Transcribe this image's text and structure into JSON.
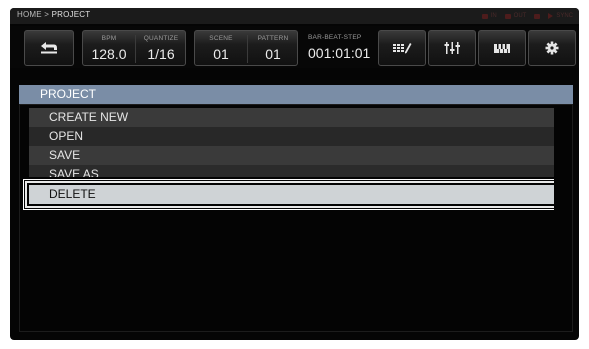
{
  "status": {
    "breadcrumb_home": "HOME",
    "breadcrumb_sep": ">",
    "breadcrumb_current": "PROJECT",
    "indicators": [
      "IN",
      "OUT",
      "",
      "SYNC"
    ]
  },
  "toolbar": {
    "bpm_label": "BPM",
    "bpm_value": "128.0",
    "quantize_label": "QUANTIZE",
    "quantize_value": "1/16",
    "scene_label": "SCENE",
    "scene_value": "01",
    "pattern_label": "PATTERN",
    "pattern_value": "01",
    "position_label": "BAR-BEAT-STEP",
    "position_value": "001:01:01",
    "icons": [
      "back-icon",
      "sequence-edit-icon",
      "mixer-icon",
      "keyboard-icon",
      "gear-icon"
    ]
  },
  "panel": {
    "title": "PROJECT",
    "items": [
      {
        "label": "CREATE NEW"
      },
      {
        "label": "OPEN"
      },
      {
        "label": "SAVE"
      },
      {
        "label": "SAVE AS"
      },
      {
        "label": "DELETE"
      }
    ],
    "selected_index": 4
  },
  "colors": {
    "header_accent": "#7a8da6",
    "selected_row": "#cfd3d6",
    "indicator_inactive": "#4d1c1c"
  }
}
